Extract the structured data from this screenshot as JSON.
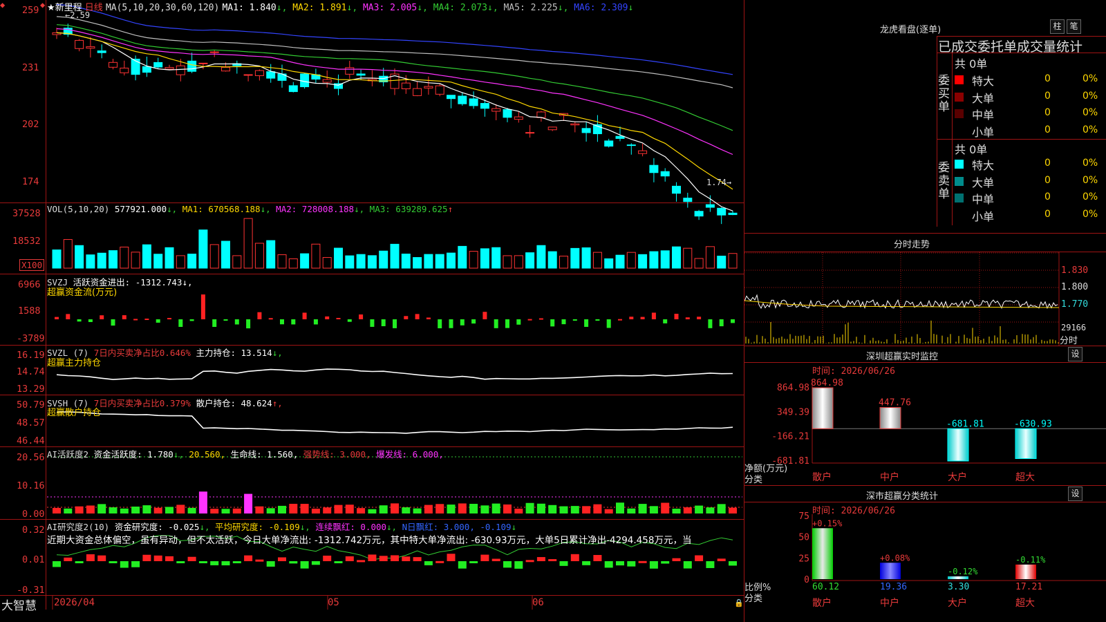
{
  "app": {
    "brand": "大智慧",
    "stock_name": "★新里程",
    "period": "日线",
    "lock_icon": "lock-icon"
  },
  "main_chart": {
    "ma_header": "MA(5,10,20,30,60,120)",
    "ma": [
      {
        "label": "MA1:",
        "value": "1.840",
        "arrow": "↓",
        "color": "#ffffff"
      },
      {
        "label": "MA2:",
        "value": "1.891",
        "arrow": "↓",
        "color": "#ffd800"
      },
      {
        "label": "MA3:",
        "value": "2.005",
        "arrow": "↓",
        "color": "#ff33ff"
      },
      {
        "label": "MA4:",
        "value": "2.073",
        "arrow": "↓",
        "color": "#33cc33"
      },
      {
        "label": "MA5:",
        "value": "2.225",
        "arrow": "↓",
        "color": "#bfbfbf"
      },
      {
        "label": "MA6:",
        "value": "2.309",
        "arrow": "↓",
        "color": "#3344ff"
      }
    ],
    "y_labels": [
      "259",
      "231",
      "202",
      "174"
    ],
    "high_marker": "2.59",
    "low_marker": "1.74",
    "high_arrow": "←",
    "low_arrow": "→"
  },
  "volume": {
    "header": "VOL(5,10,20)",
    "value": "577921.000",
    "ma": [
      {
        "label": "MA1:",
        "value": "670568.188",
        "arrow": "↓",
        "color": "#ffd800"
      },
      {
        "label": "MA2:",
        "value": "728008.188",
        "arrow": "↓",
        "color": "#ff33ff"
      },
      {
        "label": "MA3:",
        "value": "639289.625",
        "arrow": "↑",
        "color": "#33cc33"
      }
    ],
    "y_labels": [
      "37528",
      "18532"
    ],
    "unit": "X100"
  },
  "svzj": {
    "header": "SVZJ",
    "line1": "活跃资金进出: -1312.743",
    "line1_arrow": "↓,",
    "line2": "超赢资金流(万元)",
    "y_labels": [
      "6966",
      "1588",
      "-3789"
    ]
  },
  "svzl": {
    "header": "SVZL (7)",
    "ratio": "7日内买卖净占比0.646%",
    "hold": "主力持仓: 13.514",
    "hold_arrow": "↓,",
    "line2": "超赢主力持仓",
    "y_labels": [
      "16.19",
      "14.74",
      "13.29"
    ]
  },
  "svsh": {
    "header": "SVSH (7)",
    "ratio": "7日内买卖净占比0.379%",
    "hold": "散户持仓: 48.624",
    "hold_arrow": "↑,",
    "line2": "超赢散户持仓",
    "y_labels": [
      "50.79",
      "48.57",
      "46.44"
    ]
  },
  "ai_active": {
    "header": "AI活跃度2",
    "act": "资金活跃度: 1.780",
    "act_arrow": "↓,",
    "v2": "20.560,",
    "life": "生命线: 1.560,",
    "strong": "强势线: 3.000,",
    "burst": "爆发线: 6.000,",
    "y_labels": [
      "20.56",
      "10.16",
      "0.00"
    ]
  },
  "ai_research": {
    "header": "AI研究度2(10)",
    "res": "资金研究度: -0.025",
    "res_arrow": "↓,",
    "avg": "平均研究度: -0.109",
    "avg_arrow": "↓,",
    "red": "连续飘红: 0.000",
    "red_arrow": "↓,",
    "nred": "N日飘红: 3.000, -0.109",
    "nred_arrow": "↓",
    "comment": "近期大资金总体偏空，虽有异动，但不太活跃，今日大单净流出: -1312.742万元，其中特大单净流出: -630.93万元，大单5日累计净出-4294.458万元，当",
    "y_labels": [
      "0.32",
      "0.01",
      "-0.31"
    ]
  },
  "x_axis": [
    "2026/04",
    "05",
    "06"
  ],
  "dragon": {
    "title": "龙虎看盘(逐单)",
    "btn1": "柱",
    "btn2": "笔",
    "subtitle": "已成交委托单成交量统计",
    "buy_label": "委买单",
    "sell_label": "委卖单",
    "buy_total": "共 0单",
    "sell_total": "共 0单",
    "buy_rows": [
      {
        "label": "特大",
        "count": "0",
        "pct": "0%",
        "color": "#ff0000"
      },
      {
        "label": "大单",
        "count": "0",
        "pct": "0%",
        "color": "#8b0000"
      },
      {
        "label": "中单",
        "count": "0",
        "pct": "0%",
        "color": "#5a0000"
      },
      {
        "label": "小单",
        "count": "0",
        "pct": "0%",
        "color": "#000000"
      }
    ],
    "sell_rows": [
      {
        "label": "特大",
        "count": "0",
        "pct": "0%",
        "color": "#00ffff"
      },
      {
        "label": "大单",
        "count": "0",
        "pct": "0%",
        "color": "#008b8b"
      },
      {
        "label": "中单",
        "count": "0",
        "pct": "0%",
        "color": "#007070"
      },
      {
        "label": "小单",
        "count": "0",
        "pct": "0%",
        "color": "#000000"
      }
    ]
  },
  "intraday": {
    "title": "分时走势",
    "y_labels": [
      "1.830",
      "1.800",
      "1.770"
    ],
    "vol_label": "29166",
    "time_label": "分时"
  },
  "sz_monitor": {
    "title": "深圳超赢实时监控",
    "set_btn": "设",
    "time": "时间: 2026/06/26",
    "y_labels": [
      "864.98",
      "349.39",
      "-166.21",
      "-681.81"
    ],
    "axis_title": "净额(万元)",
    "axis_sub": "分类",
    "categories": [
      "散户",
      "中户",
      "大户",
      "超大"
    ],
    "values": [
      864.98,
      447.76,
      -681.81,
      -630.93
    ],
    "value_labels": [
      "864.98",
      "447.76",
      "-681.81",
      "-630.93"
    ]
  },
  "sz_stats": {
    "title": "深市超赢分类统计",
    "set_btn": "设",
    "time": "时间: 2026/06/26",
    "y_labels": [
      "75",
      "50",
      "25",
      "0"
    ],
    "axis_title": "比例%",
    "axis_sub": "分类",
    "categories": [
      "散户",
      "中户",
      "大户",
      "超大"
    ],
    "values": [
      60.12,
      19.36,
      3.3,
      17.21
    ],
    "value_labels": [
      "60.12",
      "19.36",
      "3.30",
      "17.21"
    ],
    "change_labels": [
      "+0.15%",
      "+0.08%",
      "-0.12%",
      "-0.11%"
    ]
  },
  "chart_data": [
    {
      "type": "bar",
      "title": "深圳超赢实时监控",
      "ylabel": "净额(万元)",
      "categories": [
        "散户",
        "中户",
        "大户",
        "超大"
      ],
      "values": [
        864.98,
        447.76,
        -681.81,
        -630.93
      ],
      "ylim": [
        -681.81,
        864.98
      ]
    },
    {
      "type": "bar",
      "title": "深市超赢分类统计",
      "ylabel": "比例%",
      "categories": [
        "散户",
        "中户",
        "大户",
        "超大"
      ],
      "values": [
        60.12,
        19.36,
        3.3,
        17.21
      ],
      "ylim": [
        0,
        75
      ]
    }
  ]
}
